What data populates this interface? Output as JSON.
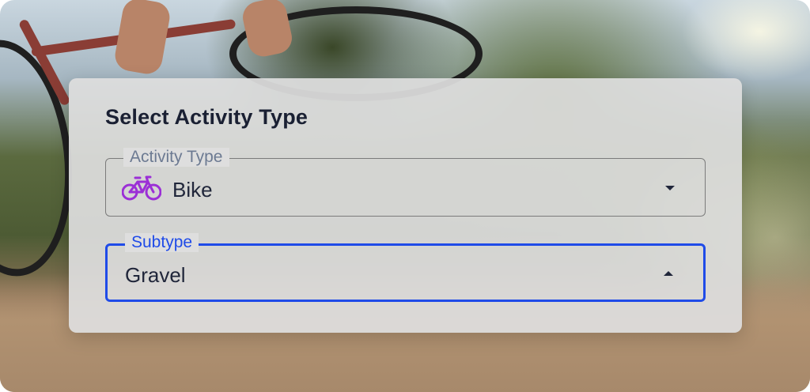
{
  "dialog": {
    "title": "Select Activity Type"
  },
  "activity_field": {
    "label": "Activity Type",
    "value": "Bike",
    "icon": "bike-icon",
    "icon_color": "#9b2fd6",
    "state": "collapsed"
  },
  "subtype_field": {
    "label": "Subtype",
    "value": "Gravel",
    "state": "expanded",
    "accent_color": "#1f4be8"
  },
  "background": {
    "subject": "gravel cyclist on dirt trail"
  }
}
